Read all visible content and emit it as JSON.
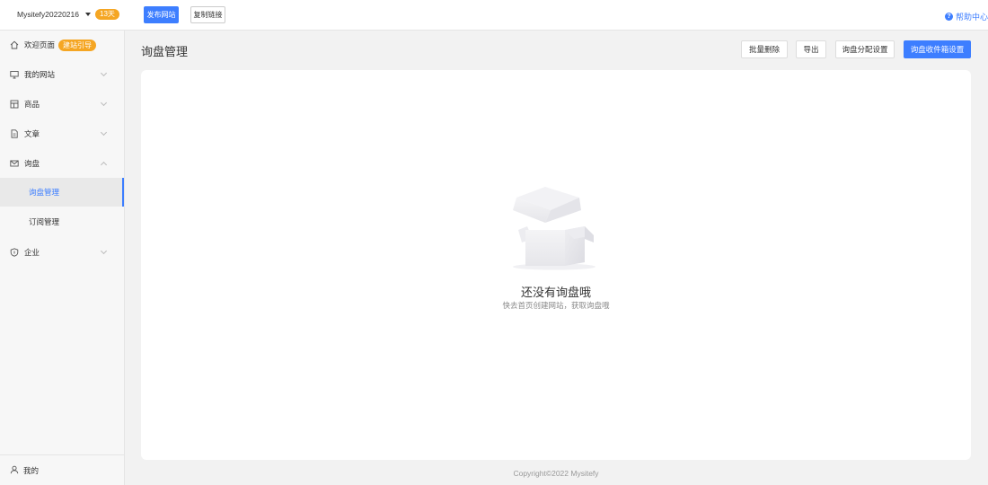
{
  "topbar": {
    "site_name": "Mysitefy20220216",
    "days_badge": "13天",
    "publish_label": "发布网站",
    "copy_label": "复制链接",
    "help_label": "帮助中心"
  },
  "sidebar": {
    "welcome": {
      "label": "欢迎页面",
      "badge": "建站引导",
      "icon": "home-icon"
    },
    "items": [
      {
        "label": "我的网站",
        "icon": "monitor-icon"
      },
      {
        "label": "商品",
        "icon": "grid-icon"
      },
      {
        "label": "文章",
        "icon": "document-icon"
      },
      {
        "label": "询盘",
        "icon": "mail-icon"
      }
    ],
    "sub_items": [
      {
        "label": "询盘管理",
        "active": true
      },
      {
        "label": "订阅管理",
        "active": false
      }
    ],
    "enterprise": {
      "label": "企业",
      "icon": "shield-icon"
    },
    "me": {
      "label": "我的",
      "icon": "user-icon"
    }
  },
  "main": {
    "title": "询盘管理",
    "actions": [
      {
        "label": "批量删除"
      },
      {
        "label": "导出"
      },
      {
        "label": "询盘分配设置"
      },
      {
        "label": "询盘收件箱设置",
        "primary": true
      }
    ],
    "empty": {
      "title": "还没有询盘哦",
      "desc": "快去首页创建网站，获取询盘哦"
    }
  },
  "footer": {
    "copyright": "Copyright©2022  Mysitefy"
  },
  "colors": {
    "primary": "#3d7eff",
    "badge": "#f5a623"
  }
}
